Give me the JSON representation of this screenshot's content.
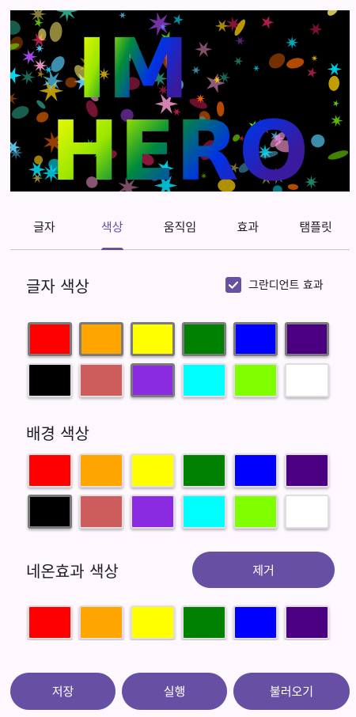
{
  "preview": {
    "line1": "IM",
    "line2": "HERO"
  },
  "tabs": [
    {
      "label": "글자",
      "active": false
    },
    {
      "label": "색상",
      "active": true
    },
    {
      "label": "움직임",
      "active": false
    },
    {
      "label": "효과",
      "active": false
    },
    {
      "label": "탬플릿",
      "active": false
    }
  ],
  "text_color": {
    "title": "글자 색상",
    "gradient_label": "그란디언트 효과",
    "gradient_checked": true,
    "selected": [
      "#ff0000",
      "#ffa500",
      "#ffff00",
      "#008000",
      "#0000ff",
      "#4b0082",
      "#8a2be2"
    ]
  },
  "background_color": {
    "title": "배경 색상",
    "selected": [
      "#000000"
    ]
  },
  "neon_color": {
    "title": "네온효과 색상",
    "remove_label": "제거"
  },
  "palette": [
    "#ff0000",
    "#ffa500",
    "#ffff00",
    "#008000",
    "#0000ff",
    "#4b0082",
    "#000000",
    "#cd5c5c",
    "#8a2be2",
    "#00ffff",
    "#7fff00",
    "#ffffff"
  ],
  "buttons": {
    "save": "저장",
    "run": "실행",
    "load": "불러오기"
  },
  "colors": {
    "accent": "#6750a4",
    "background": "#fdf7fe"
  }
}
